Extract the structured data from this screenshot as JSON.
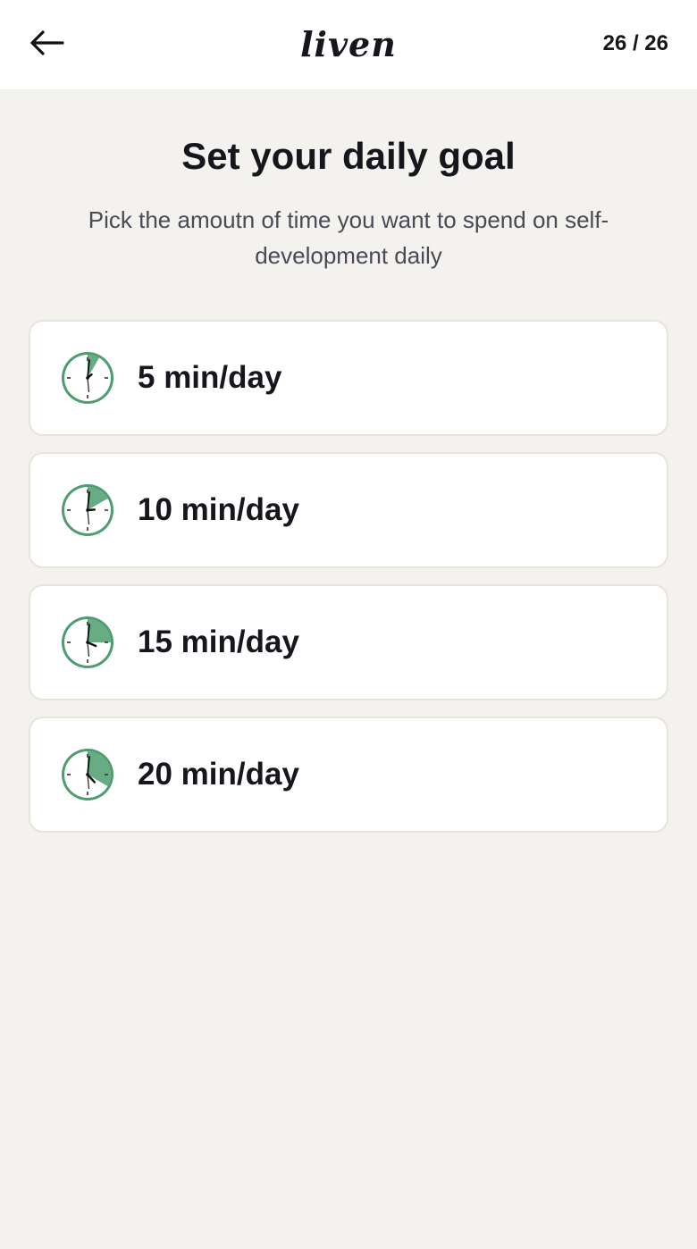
{
  "header": {
    "logo": "liven",
    "progress": "26 / 26"
  },
  "page": {
    "title": "Set your daily goal",
    "subtitle": "Pick the amoutn of time you want to spend on self-development daily"
  },
  "options": [
    {
      "label": "5 min/day",
      "minutes": 5
    },
    {
      "label": "10 min/day",
      "minutes": 10
    },
    {
      "label": "15 min/day",
      "minutes": 15
    },
    {
      "label": "20 min/day",
      "minutes": 20
    }
  ],
  "colors": {
    "accent": "#4e9d6f",
    "background": "#f4f2ee",
    "card": "#ffffff",
    "card_border": "#e8e4da",
    "text": "#16161d"
  },
  "icons": {
    "back": "arrow-left-icon",
    "option": "clock-icon"
  }
}
